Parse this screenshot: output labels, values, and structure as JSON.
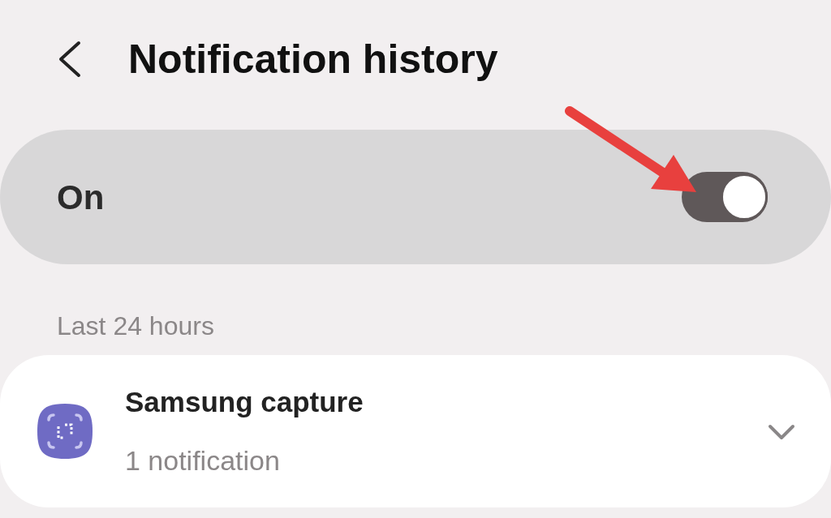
{
  "header": {
    "title": "Notification history"
  },
  "master_switch": {
    "label": "On",
    "on": true
  },
  "section": {
    "label": "Last 24 hours"
  },
  "apps": [
    {
      "name": "Samsung capture",
      "count": "1 notification",
      "expanded": false
    }
  ]
}
